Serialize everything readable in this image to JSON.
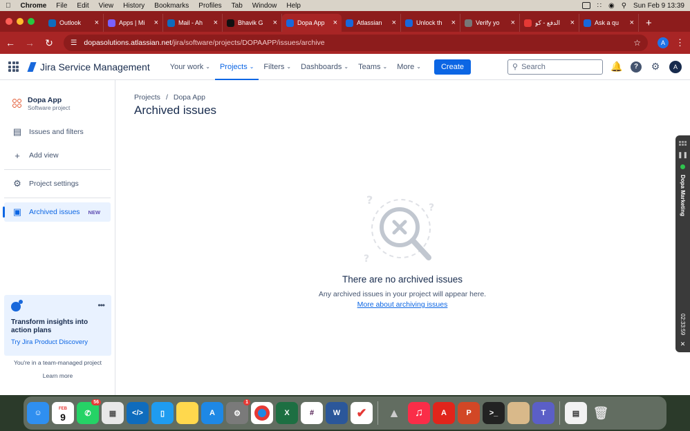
{
  "macos": {
    "menubar": {
      "app_name": "Chrome",
      "menus": [
        "File",
        "Edit",
        "View",
        "History",
        "Bookmarks",
        "Profiles",
        "Tab",
        "Window",
        "Help"
      ],
      "clock": "Sun Feb 9  13:39"
    }
  },
  "browser": {
    "tabs": [
      {
        "title": "Outlook",
        "favicon_color": "#0f6cbd",
        "active": false
      },
      {
        "title": "Apps | Mi",
        "favicon_color": "#7b61ff",
        "active": false
      },
      {
        "title": "Mail - Ah",
        "favicon_color": "#0f6cbd",
        "active": false
      },
      {
        "title": "Bhavik G",
        "favicon_color": "#111111",
        "active": false
      },
      {
        "title": "Dopa App",
        "favicon_color": "#1868db",
        "active": true
      },
      {
        "title": "Atlassian",
        "favicon_color": "#1868db",
        "active": false
      },
      {
        "title": "Unlock th",
        "favicon_color": "#1868db",
        "active": false
      },
      {
        "title": "Verify yo",
        "favicon_color": "#777777",
        "active": false
      },
      {
        "title": "الدفع - كو",
        "favicon_color": "#e53935",
        "active": false
      },
      {
        "title": "Ask a qu",
        "favicon_color": "#1868db",
        "active": false
      }
    ],
    "url_host": "dopasolutions.atlassian.net",
    "url_path": "/jira/software/projects/DOPAAPP/issues/archive",
    "profile_initial": "A"
  },
  "jira": {
    "product_name": "Jira Service Management",
    "nav": [
      {
        "label": "Your work",
        "active": false
      },
      {
        "label": "Projects",
        "active": true
      },
      {
        "label": "Filters",
        "active": false
      },
      {
        "label": "Dashboards",
        "active": false
      },
      {
        "label": "Teams",
        "active": false
      },
      {
        "label": "More",
        "active": false
      }
    ],
    "create_label": "Create",
    "search_placeholder": "Search",
    "avatar_initial": "A",
    "sidebar": {
      "project_name": "Dopa App",
      "project_type": "Software project",
      "items": [
        {
          "label": "Issues and filters",
          "icon": "issues-icon"
        },
        {
          "label": "Add view",
          "icon": "plus-icon"
        },
        {
          "label": "Project settings",
          "icon": "gear-icon"
        },
        {
          "label": "Archived issues",
          "icon": "archive-icon",
          "badge": "NEW",
          "active": true
        }
      ],
      "promo": {
        "title": "Transform insights into action plans",
        "link": "Try Jira Product Discovery"
      },
      "team_text": "You're in a team-managed project",
      "learn_more": "Learn more"
    },
    "main": {
      "breadcrumb": [
        "Projects",
        "Dopa App"
      ],
      "breadcrumb_sep": "/",
      "title": "Archived issues",
      "empty_title": "There are no archived issues",
      "empty_desc": "Any archived issues in your project will appear here.",
      "empty_link": "More about archiving issues"
    }
  },
  "side_panel": {
    "label": "Dopa Marketing",
    "timer": "02:33:59"
  },
  "dock": {
    "calendar_month": "FEB",
    "calendar_day": "9",
    "whatsapp_badge": "56",
    "settings_badge": "1"
  },
  "colors": {
    "chrome_frame": "#8d1c1c",
    "accent": "#0c66e4"
  }
}
